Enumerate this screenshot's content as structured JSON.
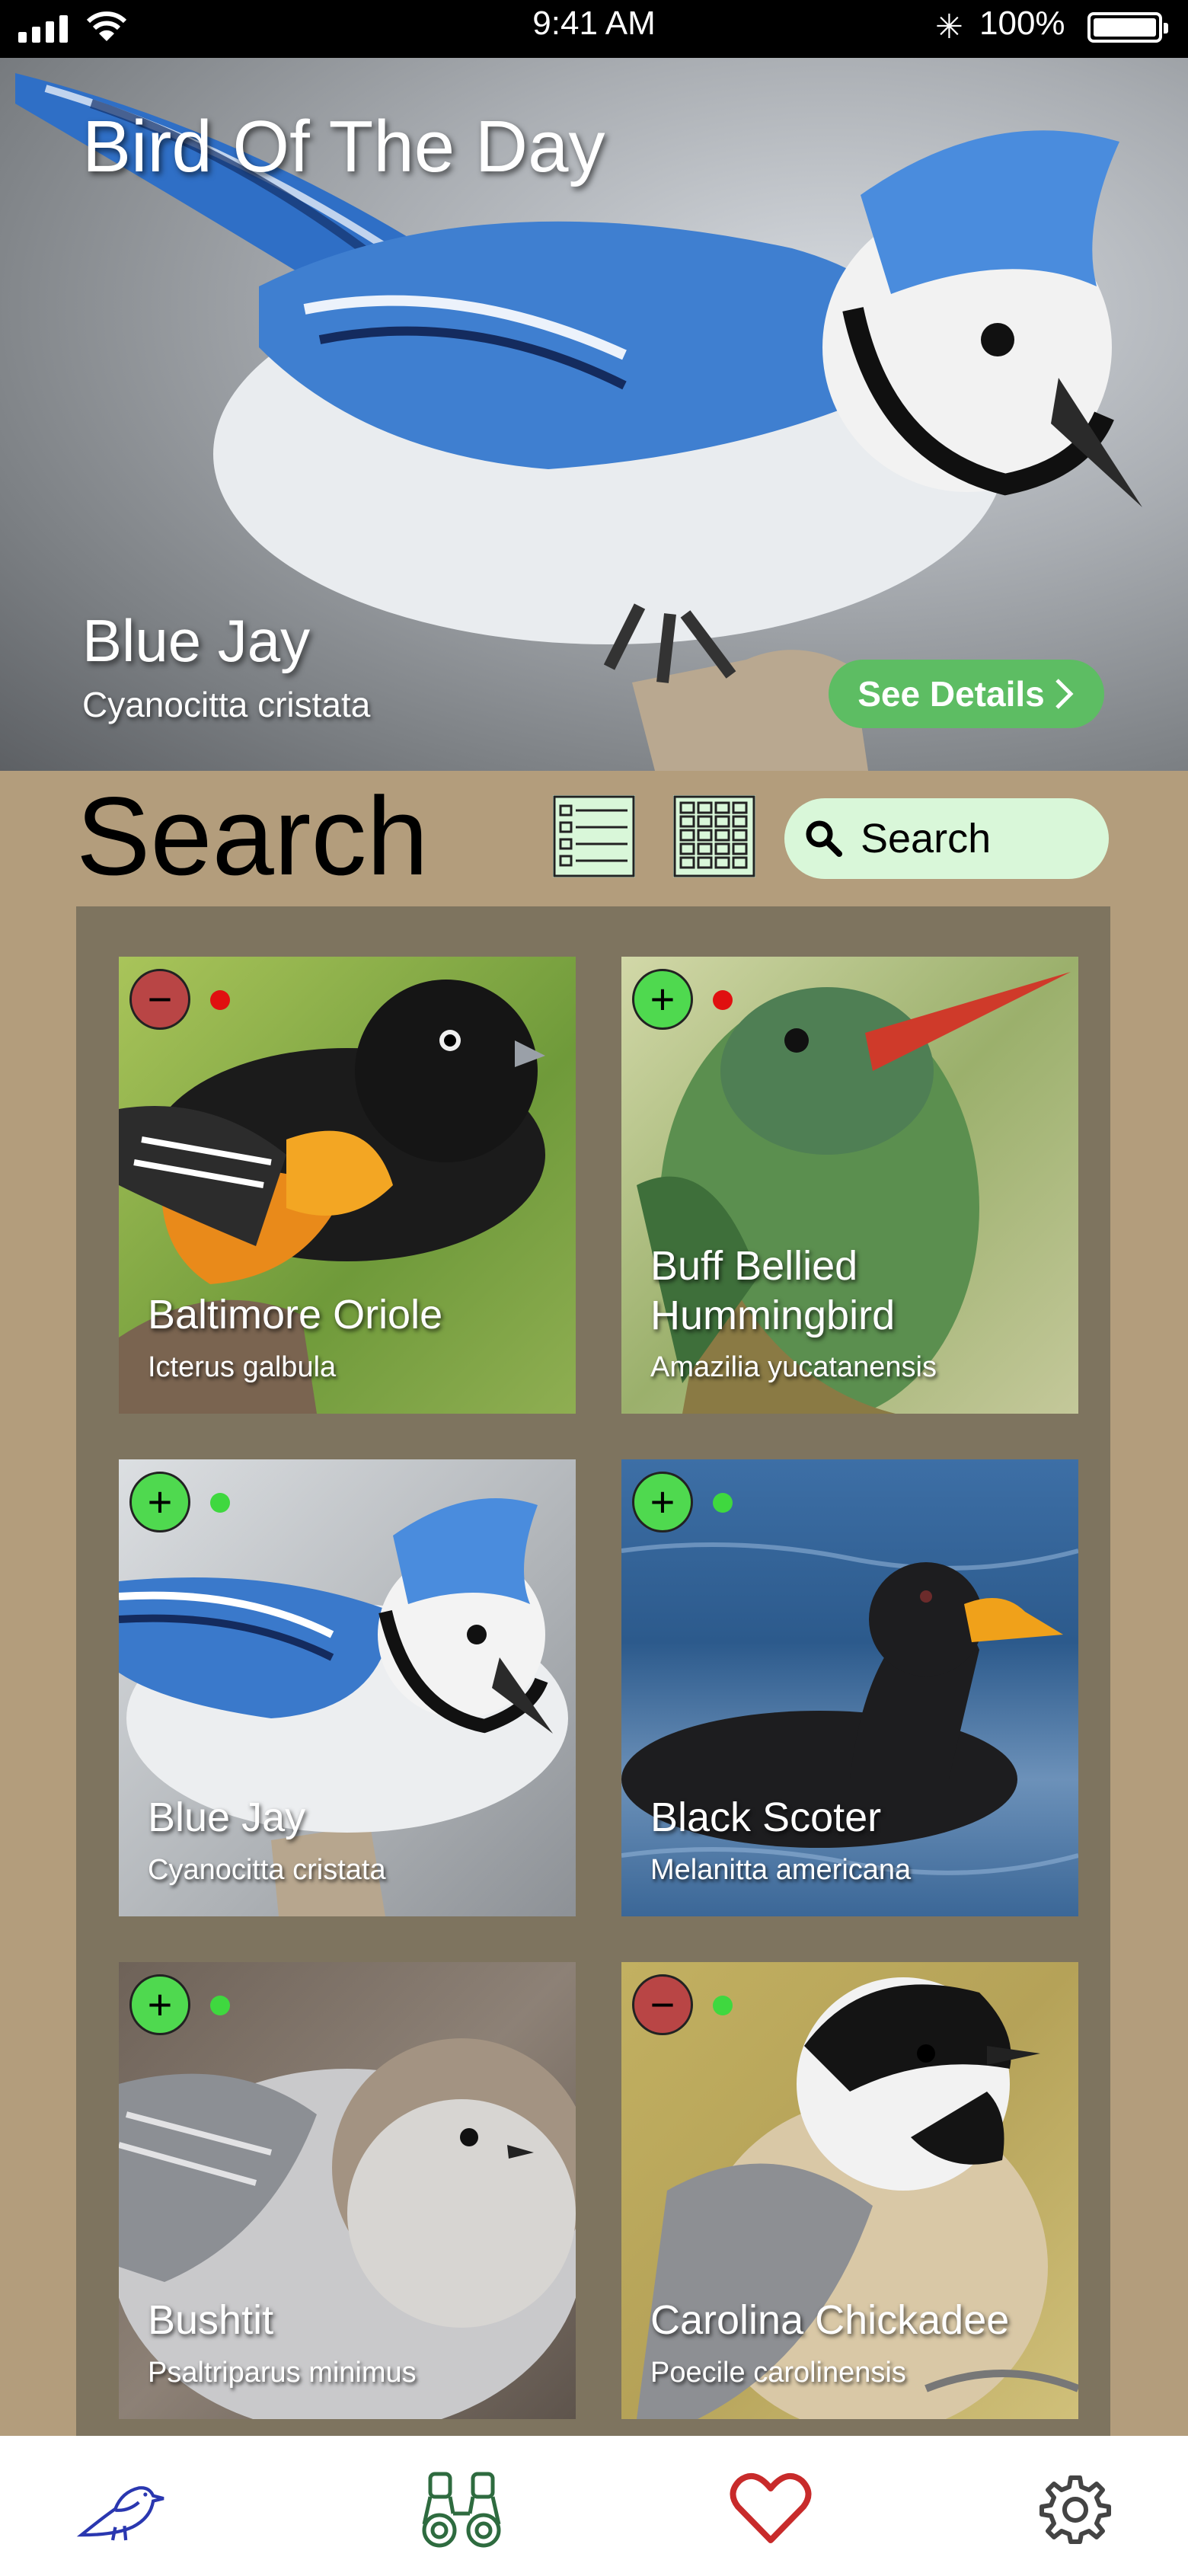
{
  "status_bar": {
    "time": "9:41 AM",
    "battery": "100%"
  },
  "hero": {
    "title": "Bird Of The Day",
    "bird_name": "Blue Jay",
    "scientific_name": "Cyanocitta cristata",
    "details_label": "See Details"
  },
  "search": {
    "title": "Search",
    "placeholder": "Search"
  },
  "birds": [
    {
      "name": "Baltimore Oriole",
      "scientific": "Icterus galbula",
      "action": "remove",
      "status_color": "#e01010"
    },
    {
      "name": "Buff Bellied Hummingbird",
      "scientific": "Amazilia yucatanensis",
      "action": "add",
      "status_color": "#e01010"
    },
    {
      "name": "Blue Jay",
      "scientific": "Cyanocitta cristata",
      "action": "add",
      "status_color": "#3fd83f"
    },
    {
      "name": "Black Scoter",
      "scientific": "Melanitta americana",
      "action": "add",
      "status_color": "#3fd83f"
    },
    {
      "name": "Bushtit",
      "scientific": "Psaltriparus minimus",
      "action": "add",
      "status_color": "#3fd83f"
    },
    {
      "name": "Carolina Chickadee",
      "scientific": "Poecile carolinensis",
      "action": "remove",
      "status_color": "#3fd83f"
    }
  ],
  "colors": {
    "accent_green": "#5dbd63",
    "remove_red": "#b94545",
    "add_green": "#4fd94f",
    "background": "#b39d7c",
    "panel": "#7e745f"
  },
  "tab_bar": {
    "tabs": [
      "bird-icon",
      "binoculars-icon",
      "heart-icon",
      "gear-icon"
    ]
  }
}
